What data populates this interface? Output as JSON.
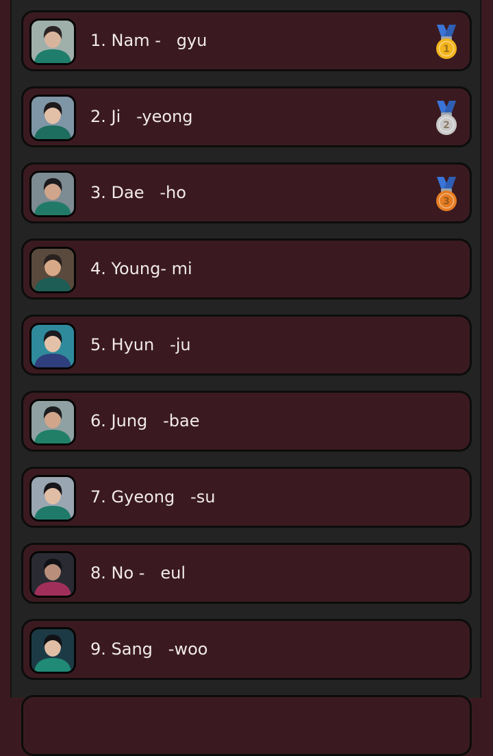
{
  "players": [
    {
      "label": "1. Nam -   gyu",
      "medal": "gold-medal",
      "photo": {
        "bg": "#9fb0aa",
        "skin": "#d9b49c",
        "hair": "#2b2424",
        "shirt": "#1f7d6b"
      }
    },
    {
      "label": "2. Ji   -yeong",
      "medal": "silver-medal",
      "photo": {
        "bg": "#7f96a6",
        "skin": "#e2c0a7",
        "hair": "#1e1a1c",
        "shirt": "#1d6e5e"
      }
    },
    {
      "label": "3. Dae   -ho",
      "medal": "bronze-medal",
      "photo": {
        "bg": "#7d8b92",
        "skin": "#cfa58b",
        "hair": "#1b1a1d",
        "shirt": "#217a67"
      }
    },
    {
      "label": "4. Young- mi",
      "medal": null,
      "photo": {
        "bg": "#5a4a3e",
        "skin": "#d7a988",
        "hair": "#2a2220",
        "shirt": "#1d5d55"
      }
    },
    {
      "label": "5. Hyun   -ju",
      "medal": null,
      "photo": {
        "bg": "#2f8a9c",
        "skin": "#e3c1a8",
        "hair": "#1a1a1f",
        "shirt": "#2f3e7c"
      }
    },
    {
      "label": "6. Jung   -bae",
      "medal": null,
      "photo": {
        "bg": "#8fa1a2",
        "skin": "#d0a58a",
        "hair": "#1d1d1f",
        "shirt": "#217f68"
      }
    },
    {
      "label": "7. Gyeong   -su",
      "medal": null,
      "photo": {
        "bg": "#9aa6b2",
        "skin": "#e0bea5",
        "hair": "#17161a",
        "shirt": "#207a69"
      }
    },
    {
      "label": "8. No -   eul",
      "medal": null,
      "photo": {
        "bg": "#2a2a33",
        "skin": "#b98f7c",
        "hair": "#121216",
        "shirt": "#a0305a"
      }
    },
    {
      "label": "9. Sang   -woo",
      "medal": null,
      "photo": {
        "bg": "#1c3a45",
        "skin": "#dfbea5",
        "hair": "#121216",
        "shirt": "#1f8a76"
      }
    }
  ],
  "colors": {
    "page_background": "#3a1a20",
    "panel": "#232323",
    "row_background": "#3a1a20",
    "row_border": "#0c0c0c",
    "name_text": "#f1eaeb",
    "ribbon_blue": "#3a74d6",
    "gold": "#f3b41d",
    "silver": "#c9c9c9",
    "bronze": "#e67c22"
  }
}
